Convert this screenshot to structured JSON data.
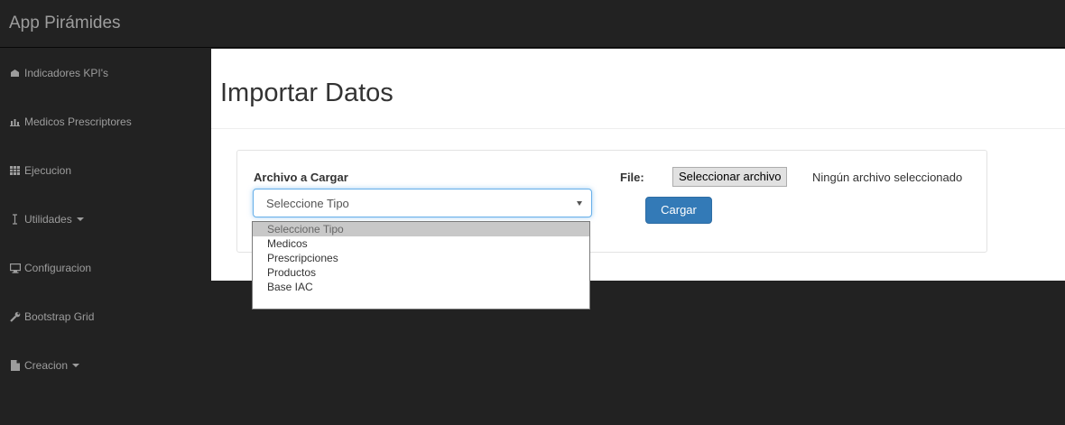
{
  "app": {
    "title": "App Pirámides"
  },
  "sidebar": {
    "items": [
      {
        "label": "Indicadores KPI's",
        "icon": "dashboard-icon"
      },
      {
        "label": "Medicos Prescriptores",
        "icon": "bar-chart-icon"
      },
      {
        "label": "Ejecucion",
        "icon": "table-icon"
      },
      {
        "label": "Utilidades",
        "icon": "cursor-icon",
        "has_caret": true
      },
      {
        "label": "Configuracion",
        "icon": "desktop-icon"
      },
      {
        "label": "Bootstrap Grid",
        "icon": "wrench-icon"
      },
      {
        "label": "Creacion",
        "icon": "file-icon",
        "has_caret": true
      }
    ]
  },
  "main": {
    "title": "Importar Datos",
    "form": {
      "type_label": "Archivo a Cargar",
      "type_select_value": "Seleccione Tipo",
      "type_options": [
        "Seleccione Tipo",
        "Medicos",
        "Prescripciones",
        "Productos",
        "Base IAC"
      ],
      "file_label": "File:",
      "file_button_label": "Seleccionar archivo",
      "file_status": "Ningún archivo seleccionado",
      "submit_label": "Cargar"
    }
  },
  "colors": {
    "navbar_bg": "#222222",
    "primary": "#337ab7",
    "focus": "#66afe9"
  }
}
